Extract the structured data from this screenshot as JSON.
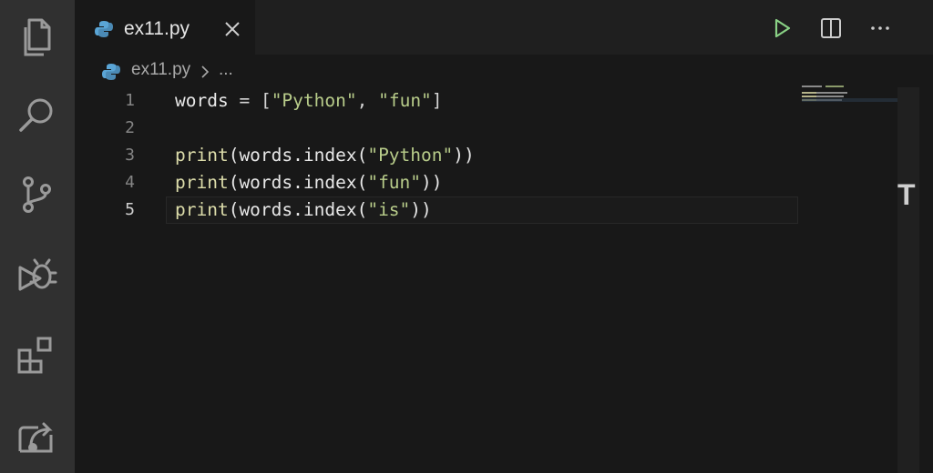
{
  "activity_bar": {
    "items": [
      {
        "name": "explorer",
        "icon": "files-icon"
      },
      {
        "name": "search",
        "icon": "search-icon"
      },
      {
        "name": "source-control",
        "icon": "source-control-icon"
      },
      {
        "name": "run-debug",
        "icon": "debug-icon"
      },
      {
        "name": "extensions",
        "icon": "extensions-icon"
      },
      {
        "name": "remote",
        "icon": "remote-icon"
      }
    ]
  },
  "tab": {
    "label": "ex11.py",
    "icon": "python-icon",
    "close_icon": "close-icon"
  },
  "toolbar": {
    "run_icon": "play-icon",
    "split_icon": "split-editor-icon",
    "more_icon": "ellipsis-icon",
    "run_color": "#89d185"
  },
  "breadcrumb": {
    "file": "ex11.py",
    "more": "..."
  },
  "code": {
    "lines": [
      {
        "number": "1"
      },
      {
        "number": "2"
      },
      {
        "number": "3"
      },
      {
        "number": "4"
      },
      {
        "number": "5"
      }
    ],
    "tokens": {
      "l1_var": "words",
      "l1_eq": " = ",
      "l1_open": "[",
      "l1_s1": "\"Python\"",
      "l1_comma": ", ",
      "l1_s2": "\"fun\"",
      "l1_close": "]",
      "print": "print",
      "call": "(words.index(",
      "l3_arg": "\"Python\"",
      "l4_arg": "\"fun\"",
      "l5_arg": "\"is\"",
      "close2": "))"
    }
  },
  "scroll_marker": "T"
}
